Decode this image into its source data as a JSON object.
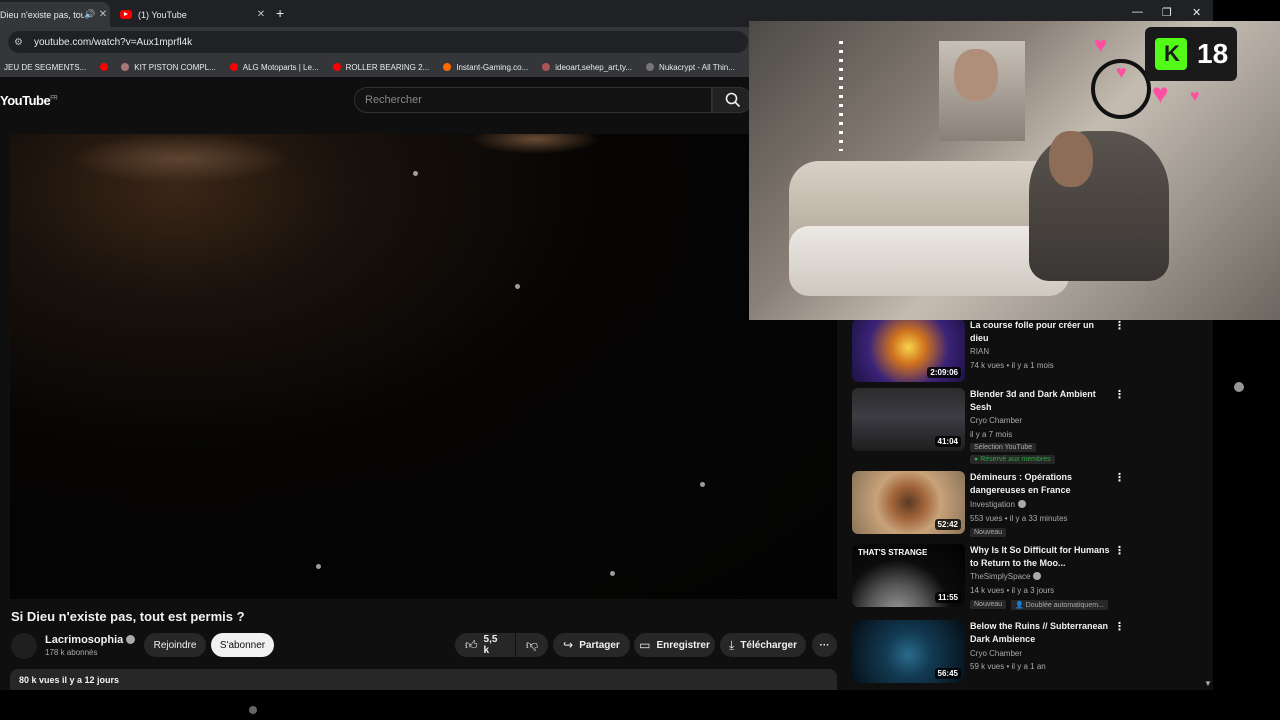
{
  "browser": {
    "tabs": [
      {
        "title": "Dieu n'existe pas, tout"
      },
      {
        "title": "(1) YouTube"
      }
    ],
    "new_tab_symbol": "+",
    "url": "youtube.com/watch?v=Aux1mprfl4k",
    "window_controls": {
      "minimize": "—",
      "restore": "❐",
      "close": "✕"
    },
    "bookmarks": [
      {
        "label": "JEU DE SEGMENTS...",
        "color": "#35363a"
      },
      {
        "label": "KIT PISTON COMPL...",
        "color": "#ff0000"
      },
      {
        "label": "ALG Motoparts | Le...",
        "color": "#ff0000"
      },
      {
        "label": "ROLLER BEARING 2...",
        "color": "#ff0000"
      },
      {
        "label": "Instant-Gaming.co...",
        "color": "#ff6a00"
      },
      {
        "label": "ideoart,sehep_art,ty...",
        "color": "#a55"
      },
      {
        "label": "Nukacrypt - All Thin...",
        "color": "#777"
      }
    ]
  },
  "youtube": {
    "logo": "YouTube",
    "logo_region": "FR",
    "search_placeholder": "Rechercher",
    "video_title": "Si Dieu n'existe pas, tout est permis ?",
    "channel": {
      "name": "Lacrimosophia",
      "subscribers": "178 k abonnés",
      "join_label": "Rejoindre",
      "subscribe_label": "S'abonner"
    },
    "actions": {
      "likes": "5,5 k",
      "share": "Partager",
      "save": "Enregistrer",
      "download": "Télécharger",
      "more": "···"
    },
    "description_meta": "80 k vues   il y a 12 jours"
  },
  "recommendations": [
    {
      "title": "La course folle pour créer un dieu",
      "channel": "RIAN",
      "meta": "74 k vues • il y a 1 mois",
      "duration": "2:09:06",
      "verified": false,
      "badges": []
    },
    {
      "title": "Blender 3d and Dark Ambient Sesh",
      "channel": "Cryo Chamber",
      "meta": "il y a 7 mois",
      "duration": "41:04",
      "verified": false,
      "badges": [
        "Sélection YouTube",
        "Réservé aux membres"
      ]
    },
    {
      "title": "Démineurs : Opérations dangereuses en France",
      "channel": "Investigation",
      "meta": "553 vues • il y a 33 minutes",
      "duration": "52:42",
      "verified": true,
      "badges": [
        "Nouveau"
      ]
    },
    {
      "title": "Why Is It So Difficult for Humans to Return to the Moo...",
      "channel": "TheSimplySpace",
      "meta": "14 k vues • il y a 3 jours",
      "duration": "11:55",
      "verified": true,
      "badges": [
        "Nouveau",
        "Doublée automatiquem..."
      ],
      "thumb_text": "THAT'S STRANGE"
    },
    {
      "title": "Below the Ruins // Subterranean Dark Ambience",
      "channel": "Cryo Chamber",
      "meta": "59 k vues • il y a 1 an",
      "duration": "56:45",
      "verified": false,
      "badges": []
    }
  ],
  "stream_overlay": {
    "viewer_count": "18"
  },
  "colors": {
    "accent_red": "#ff0000",
    "kick_green": "#53fc18",
    "member_green": "#2ba640",
    "heart_pink": "#ff4fa1"
  }
}
